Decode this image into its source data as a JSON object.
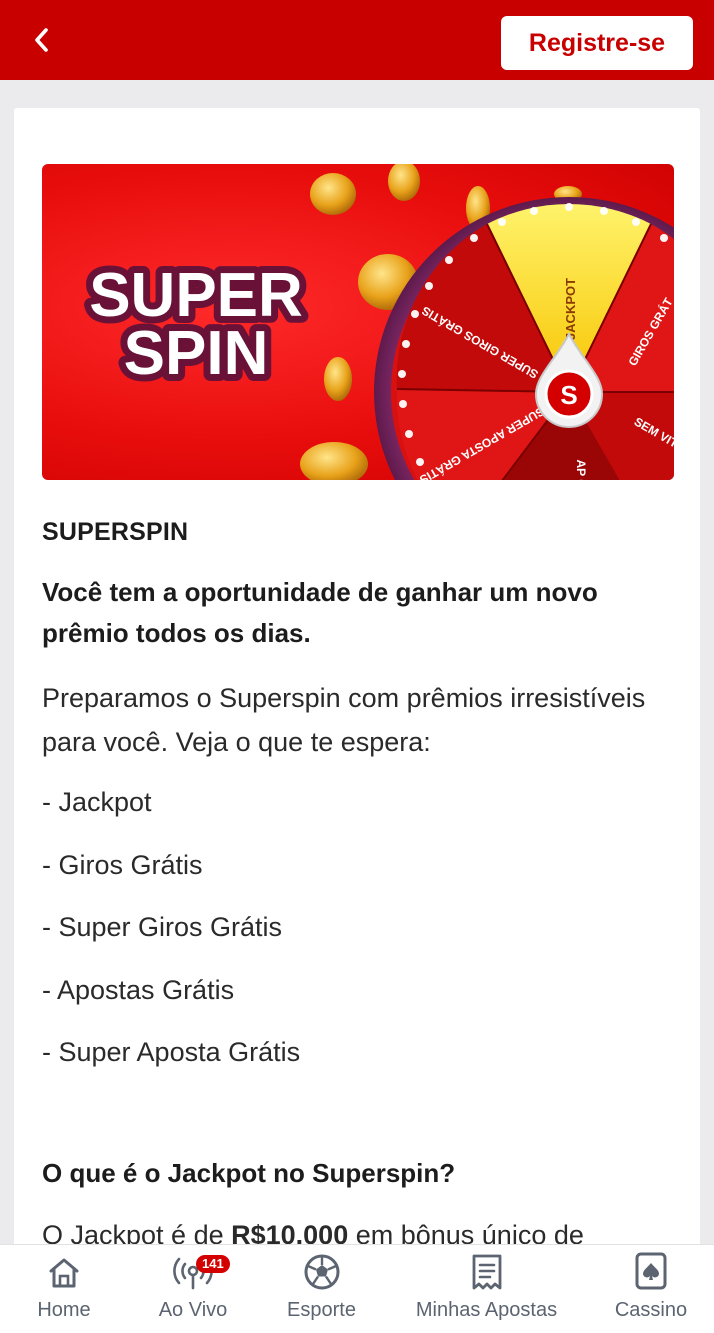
{
  "header": {
    "back_icon": "chevron-left-icon",
    "register_label": "Registre-se"
  },
  "banner": {
    "title_line1": "SUPER",
    "title_line2": "SPIN",
    "wheel_segments": [
      "JACKPOT",
      "SUPER GIROS GRÁTIS",
      "GIROS GRÁT",
      "SUPER APOSTA GRÁTIS",
      "SEM VIT",
      "AP G"
    ],
    "center_letter": "S"
  },
  "content": {
    "heading": "SUPERSPIN",
    "lead": "Você tem a oportunidade de ganhar um novo prêmio todos os dias.",
    "paragraph": "Preparamos o Superspin com prêmios irresistíveis para você. Veja o que te espera:",
    "prizes": [
      "- Jackpot",
      "- Giros Grátis",
      "- Super Giros Grátis",
      "- Apostas Grátis",
      "- Super Aposta Grátis"
    ],
    "sub_heading": "O que é o Jackpot no Superspin?",
    "cut_para_a": "O Jackpot é de ",
    "cut_para_b": "R$10.000",
    "cut_para_c": " em bônus único de"
  },
  "nav": {
    "items": [
      {
        "label": "Home",
        "icon": "home-icon"
      },
      {
        "label": "Ao Vivo",
        "icon": "live-broadcast-icon",
        "badge": "141"
      },
      {
        "label": "Esporte",
        "icon": "soccer-ball-icon"
      },
      {
        "label": "Minhas Apostas",
        "icon": "receipt-icon"
      },
      {
        "label": "Cassino",
        "icon": "playing-card-icon"
      }
    ]
  },
  "colors": {
    "brand_red": "#c80000",
    "text_dark": "#1c1c1c",
    "nav_gray": "#5b6470"
  }
}
